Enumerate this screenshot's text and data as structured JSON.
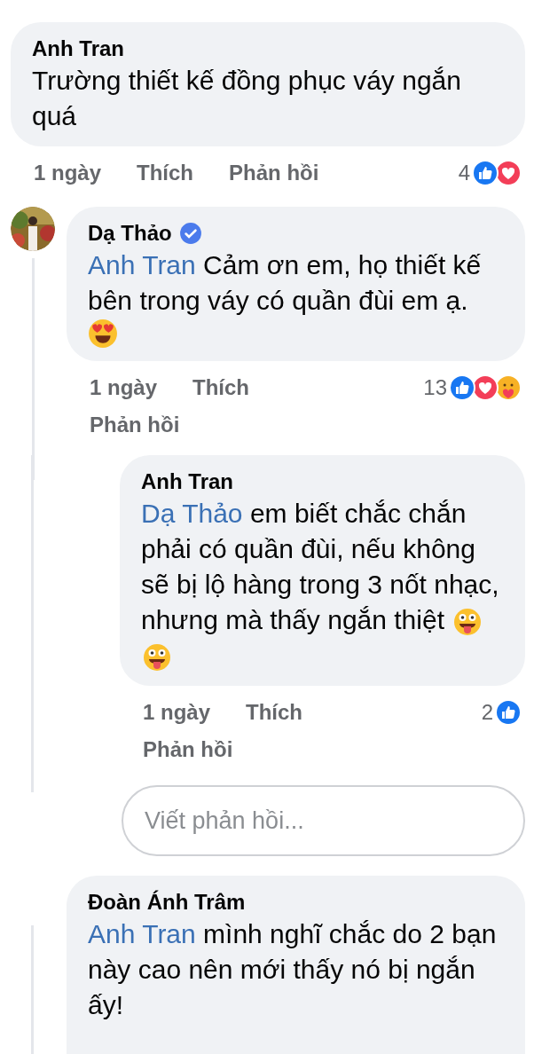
{
  "comments": [
    {
      "kind": "top",
      "author": "Anh Tran",
      "verified": false,
      "text": "Trường thiết kế đồng phục váy ngắn quá",
      "time": "1 ngày",
      "like": "Thích",
      "reply": "Phản hồi",
      "count": "4",
      "reactions": [
        {
          "kind": "like"
        },
        {
          "kind": "love"
        }
      ]
    },
    {
      "kind": "top_avatar",
      "author": "Dạ Thảo",
      "verified": true,
      "mention": "Anh Tran",
      "text": "Cảm ơn em, họ thiết kế bên trong váy có quần đùi em ạ.",
      "emojis": [
        {
          "kind": "heart_eyes"
        }
      ],
      "time": "1 ngày",
      "like": "Thích",
      "reply": "Phản hồi",
      "count": "13",
      "reactions": [
        {
          "kind": "like"
        },
        {
          "kind": "love"
        },
        {
          "kind": "care"
        }
      ]
    },
    {
      "kind": "nested",
      "author": "Anh Tran",
      "verified": false,
      "mention": "Dạ Thảo",
      "text": "em biết chắc chắn phải có quần đùi, nếu không sẽ bị lộ hàng trong 3 nốt nhạc, nhưng mà thấy ngắn thiệt",
      "emojis": [
        {
          "kind": "tongue"
        },
        {
          "kind": "tongue"
        }
      ],
      "time": "1 ngày",
      "like": "Thích",
      "reply": "Phản hồi",
      "count": "2",
      "reactions": [
        {
          "kind": "like"
        }
      ]
    }
  ],
  "reply_field": {
    "placeholder": "Viết phản hồi..."
  },
  "last_comment": {
    "author": "Đoàn Ánh Trâm",
    "mention": "Anh Tran",
    "text": "mình nghĩ chắc do 2 bạn này cao nên mới thấy nó bị ngắn ấy!"
  }
}
